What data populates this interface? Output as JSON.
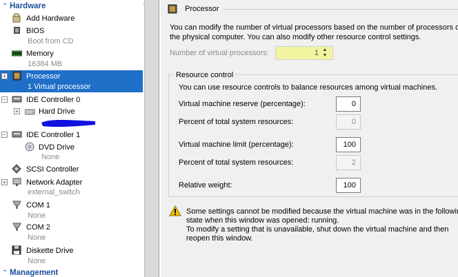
{
  "tree": {
    "hardware_header": "Hardware",
    "management_header": "Management",
    "items": {
      "add_hardware": "Add Hardware",
      "bios": "BIOS",
      "bios_sub": "Boot from CD",
      "memory": "Memory",
      "memory_sub": "16384 MB",
      "processor": "Processor",
      "processor_sub": "1 Virtual processor",
      "ide0": "IDE Controller 0",
      "hard_drive": "Hard Drive",
      "ide1": "IDE Controller 1",
      "dvd": "DVD Drive",
      "dvd_sub": "None",
      "scsi": "SCSI Controller",
      "net": "Network Adapter",
      "net_sub": "external_switch",
      "com1": "COM 1",
      "com1_sub": "None",
      "com2": "COM 2",
      "com2_sub": "None",
      "diskette": "Diskette Drive",
      "diskette_sub": "None"
    }
  },
  "panel": {
    "title": "Processor",
    "intro_line1": "You can modify the number of virtual processors based on the number of processors on",
    "intro_line2": "the physical computer. You can also modify other resource control settings.",
    "num_proc_label": "Number of virtual processors:",
    "num_proc_value": "1",
    "resource_control": {
      "legend": "Resource control",
      "desc": "You can use resource controls to balance resources among virtual machines.",
      "reserve_label": "Virtual machine reserve (percentage):",
      "reserve_value": "0",
      "pct1_label": "Percent of total system resources:",
      "pct1_value": "0",
      "limit_label": "Virtual machine limit (percentage):",
      "limit_value": "100",
      "pct2_label": "Percent of total system resources:",
      "pct2_value": "2",
      "weight_label": "Relative weight:",
      "weight_value": "100"
    },
    "warning": {
      "line1": "Some settings cannot be modified because the virtual machine was in the following",
      "line2": "state when this window was opened: running.",
      "line3": "To modify a setting that is unavailable, shut down the virtual machine and then",
      "line4": "reopen this window."
    }
  },
  "colors": {
    "selection": "#1e6fc7",
    "header_blue": "#1b4f9c",
    "highlight_yellow": "#f2f5a0",
    "redaction": "#1010e0"
  }
}
